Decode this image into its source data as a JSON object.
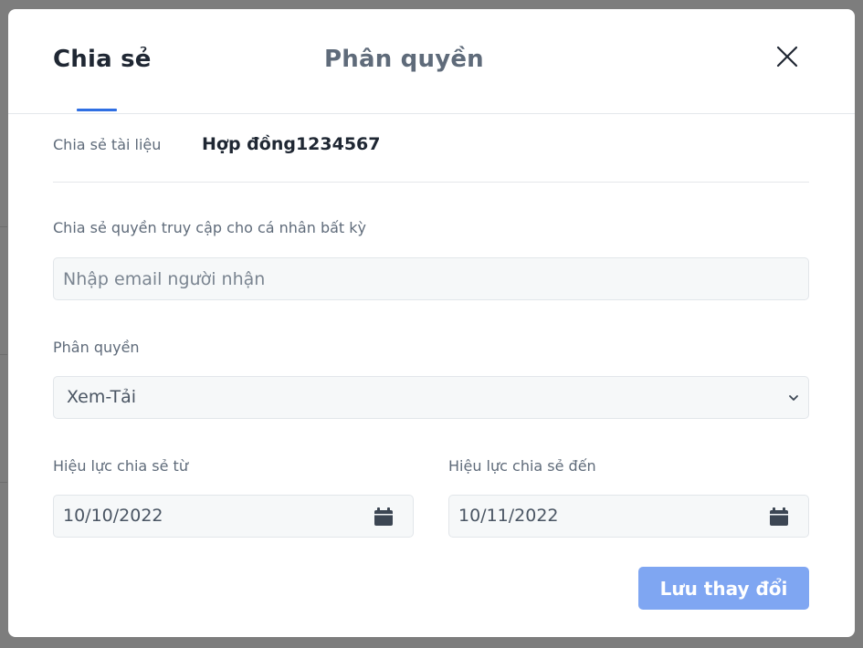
{
  "tabs": {
    "share_label": "Chia sẻ",
    "permission_label": "Phân quyền",
    "active": "share"
  },
  "close_icon": "close-icon",
  "document": {
    "label": "Chia sẻ tài liệu",
    "name": "Hợp đồng1234567"
  },
  "recipient": {
    "label": "Chia sẻ quyền truy cập cho cá nhân bất kỳ",
    "placeholder": "Nhập email người nhận",
    "value": ""
  },
  "permission": {
    "label": "Phân quyền",
    "selected": "Xem-Tải",
    "icon": "chevron-down-icon"
  },
  "valid_from": {
    "label": "Hiệu lực chia sẻ từ",
    "value": "10/10/2022",
    "icon": "calendar-icon"
  },
  "valid_to": {
    "label": "Hiệu lực chia sẻ đến",
    "value": "10/11/2022",
    "icon": "calendar-icon"
  },
  "save_label": "Lưu thay đổi",
  "colors": {
    "accent": "#2f6fe3",
    "save_button": "#7fa6f2",
    "field_background": "#f6f8f9",
    "overlay": "#7d7d7d"
  }
}
